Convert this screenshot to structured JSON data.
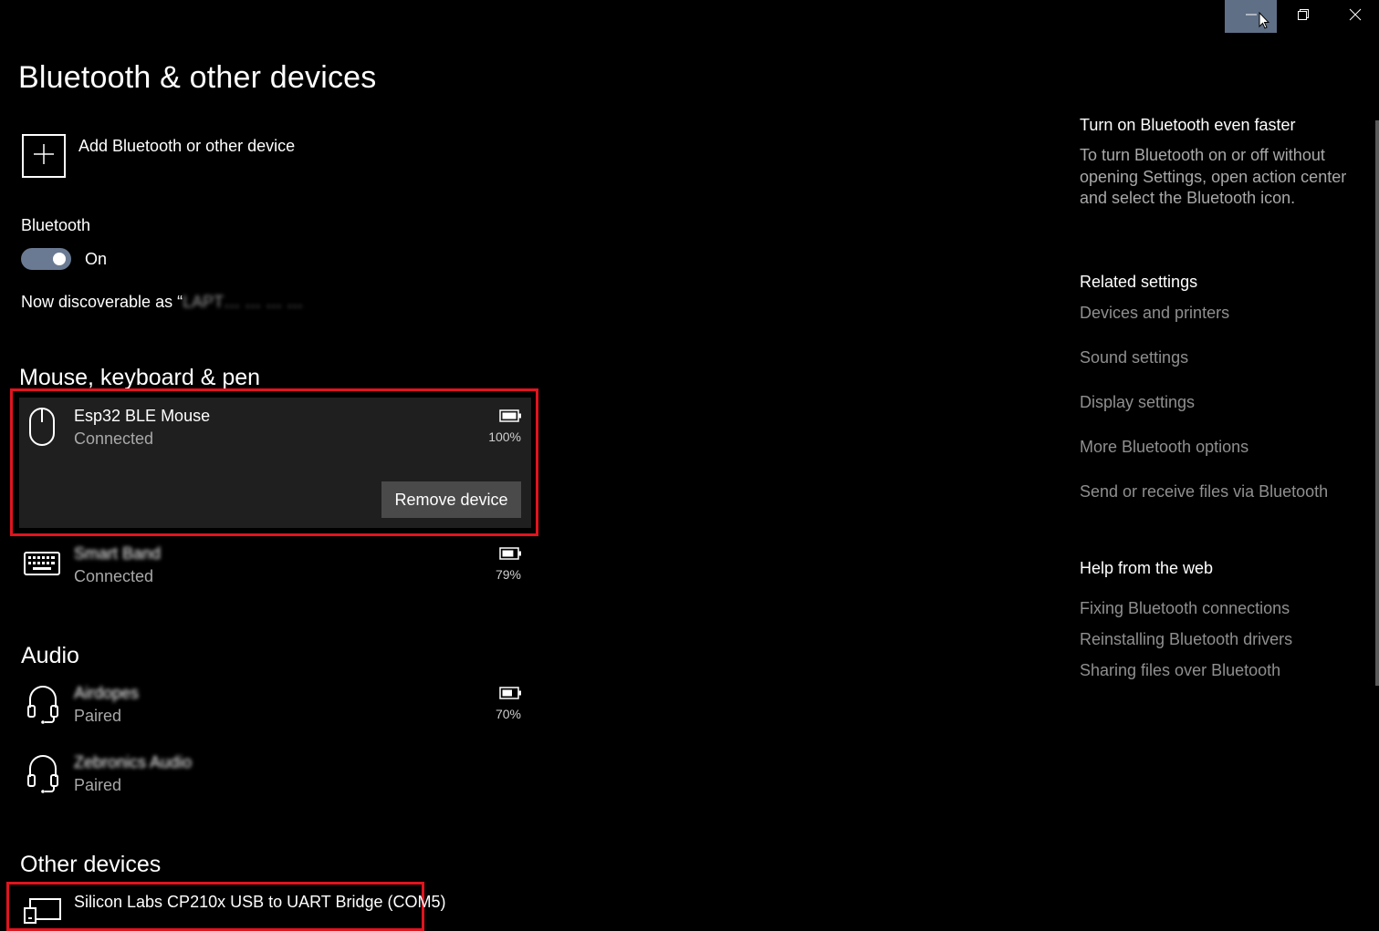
{
  "window": {
    "minimize_icon": "minimize-icon",
    "maximize_icon": "restore-icon",
    "close_icon": "close-icon"
  },
  "page": {
    "title": "Bluetooth & other devices"
  },
  "add_device": {
    "label": "Add Bluetooth or other device",
    "icon": "plus-icon"
  },
  "bluetooth": {
    "label": "Bluetooth",
    "state": "On",
    "enabled": true,
    "discoverable_prefix": "Now discoverable as “",
    "discoverable_name": "LAPT… … … …"
  },
  "sections": {
    "mouse_keyboard_pen": {
      "title": "Mouse, keyboard & pen",
      "devices": [
        {
          "name": "Esp32 BLE Mouse",
          "status": "Connected",
          "battery": "100%",
          "battery_level": 1.0,
          "icon": "mouse-icon",
          "remove_label": "Remove device"
        },
        {
          "name": "Smart Band",
          "status": "Connected",
          "battery": "79%",
          "battery_level": 0.79,
          "icon": "keyboard-icon"
        }
      ]
    },
    "audio": {
      "title": "Audio",
      "devices": [
        {
          "name": "Airdopes",
          "status": "Paired",
          "battery": "70%",
          "battery_level": 0.7,
          "icon": "headset-icon"
        },
        {
          "name": "Zebronics Audio",
          "status": "Paired",
          "icon": "headset-icon"
        }
      ]
    },
    "other_devices": {
      "title": "Other devices",
      "devices": [
        {
          "name": "Silicon Labs CP210x USB to UART Bridge (COM5)",
          "icon": "generic-device-icon"
        }
      ]
    }
  },
  "sidebar": {
    "faster": {
      "heading": "Turn on Bluetooth even faster",
      "body": "To turn Bluetooth on or off without opening Settings, open action center and select the Bluetooth icon."
    },
    "related": {
      "heading": "Related settings",
      "links": [
        "Devices and printers",
        "Sound settings",
        "Display settings",
        "More Bluetooth options",
        "Send or receive files via Bluetooth"
      ]
    },
    "help": {
      "heading": "Help from the web",
      "links": [
        "Fixing Bluetooth connections",
        "Reinstalling Bluetooth drivers",
        "Sharing files over Bluetooth"
      ]
    }
  },
  "colors": {
    "highlight": "#e0141e",
    "toggle_on": "#6a7a92",
    "background": "#000000"
  }
}
